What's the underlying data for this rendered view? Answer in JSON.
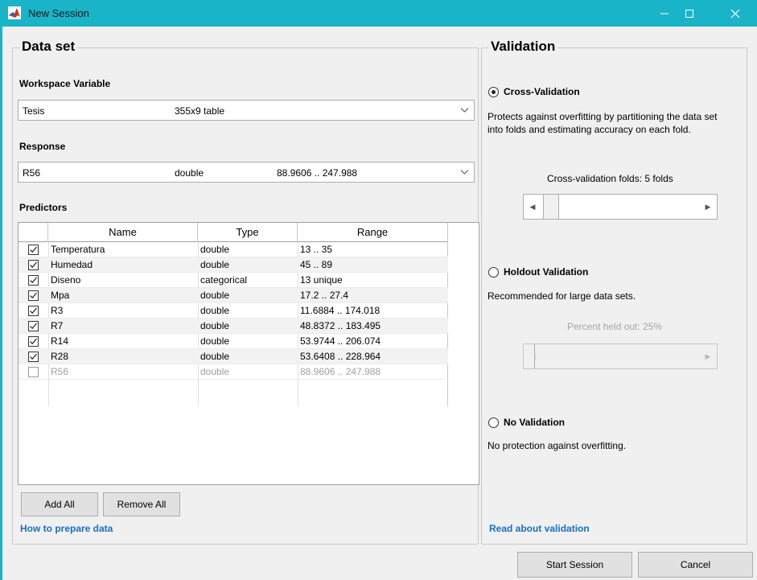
{
  "window": {
    "title": "New Session",
    "accent": "#1ab4c8"
  },
  "dataset": {
    "title": "Data set",
    "workspace": {
      "label": "Workspace Variable",
      "name": "Tesis",
      "info": "355x9 table"
    },
    "response": {
      "label": "Response",
      "name": "R56",
      "type": "double",
      "range": "88.9606 .. 247.988"
    },
    "predictors": {
      "label": "Predictors",
      "columns": [
        "Name",
        "Type",
        "Range"
      ],
      "rows": [
        {
          "checked": true,
          "name": "Temperatura",
          "type": "double",
          "range": "13 .. 35"
        },
        {
          "checked": true,
          "name": "Humedad",
          "type": "double",
          "range": "45 .. 89"
        },
        {
          "checked": true,
          "name": "Diseno",
          "type": "categorical",
          "range": "13 unique"
        },
        {
          "checked": true,
          "name": "Mpa",
          "type": "double",
          "range": "17.2 .. 27.4"
        },
        {
          "checked": true,
          "name": "R3",
          "type": "double",
          "range": "11.6884 .. 174.018"
        },
        {
          "checked": true,
          "name": "R7",
          "type": "double",
          "range": "48.8372 .. 183.495"
        },
        {
          "checked": true,
          "name": "R14",
          "type": "double",
          "range": "53.9744 .. 206.074"
        },
        {
          "checked": true,
          "name": "R28",
          "type": "double",
          "range": "53.6408 .. 228.964"
        },
        {
          "checked": false,
          "name": "R56",
          "type": "double",
          "range": "88.9606 .. 247.988"
        }
      ]
    },
    "add_all": "Add All",
    "remove_all": "Remove All",
    "help_link": "How to prepare data"
  },
  "validation": {
    "title": "Validation",
    "cross": {
      "label": "Cross-Validation",
      "selected": true,
      "desc_line1": "Protects against overfitting by partitioning the data set",
      "desc_line2": "into folds and estimating accuracy on each fold.",
      "folds_label": "Cross-validation folds: 5 folds",
      "folds_value": 5
    },
    "holdout": {
      "label": "Holdout Validation",
      "selected": false,
      "desc": "Recommended for large data sets.",
      "percent_label": "Percent held out: 25%",
      "percent_value": 25
    },
    "none": {
      "label": "No Validation",
      "selected": false,
      "desc": "No protection against overfitting."
    },
    "read_link": "Read about validation"
  },
  "actions": {
    "start": "Start Session",
    "cancel": "Cancel"
  }
}
